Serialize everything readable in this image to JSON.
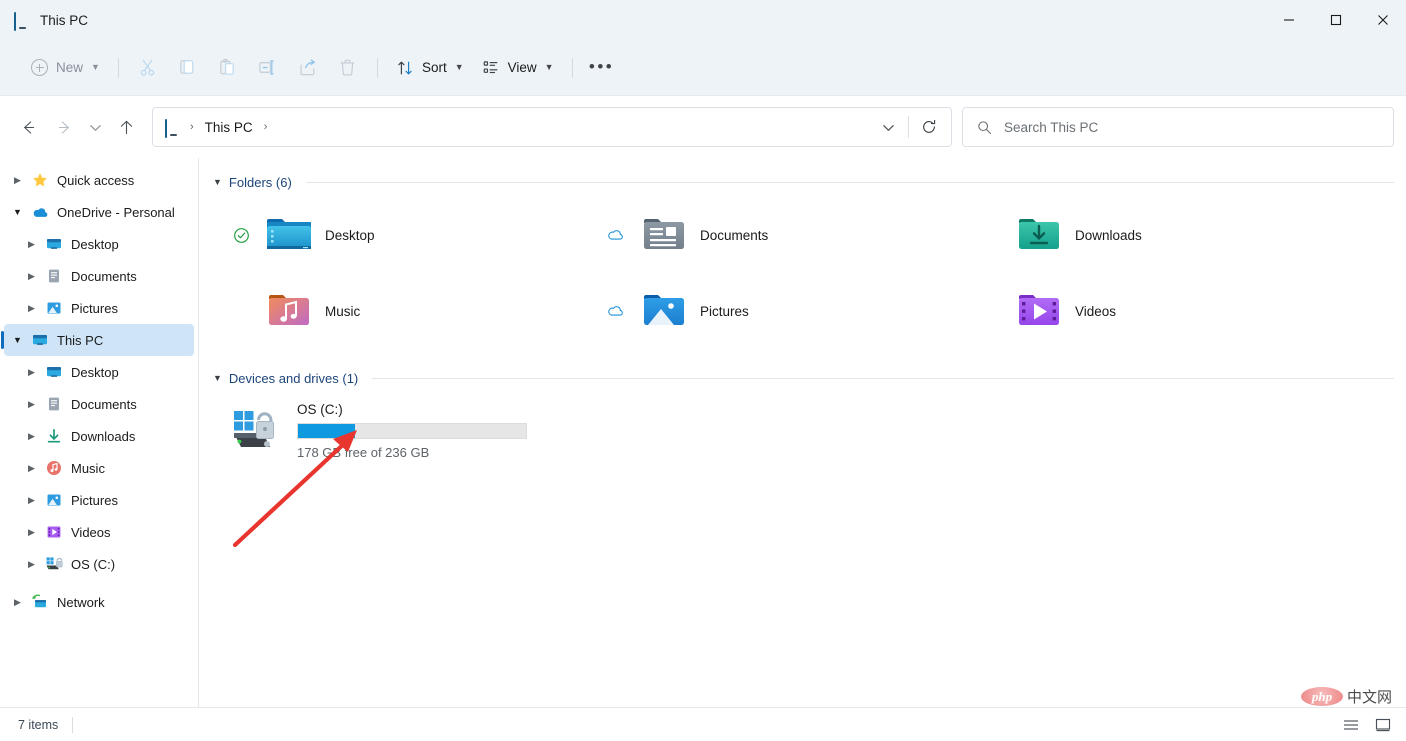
{
  "window": {
    "title": "This PC",
    "icon": "monitor-icon",
    "controls": {
      "minimize": "—",
      "maximize": "□",
      "close": "✕"
    }
  },
  "toolbar": {
    "new_label": "New",
    "sort_label": "Sort",
    "view_label": "View",
    "more_label": "•••",
    "icons": [
      "cut-icon",
      "copy-icon",
      "paste-icon",
      "rename-icon",
      "share-icon",
      "delete-icon"
    ]
  },
  "addressbar": {
    "back": "←",
    "forward": "→",
    "recent": "⌄",
    "up": "↑",
    "breadcrumbs": [
      "This PC"
    ],
    "separator": "›",
    "history_dropdown": "⌄",
    "refresh": "↻"
  },
  "search": {
    "placeholder": "Search This PC",
    "icon": "search-icon"
  },
  "sidebar": {
    "items": [
      {
        "label": "Quick access",
        "icon": "star-icon",
        "level": 1,
        "arrow": "collapsed",
        "selected": false
      },
      {
        "label": "OneDrive - Personal",
        "icon": "onedrive-icon",
        "level": 1,
        "arrow": "expanded",
        "selected": false
      },
      {
        "label": "Desktop",
        "icon": "desktop-icon",
        "level": 2,
        "arrow": "collapsed",
        "selected": false
      },
      {
        "label": "Documents",
        "icon": "documents-grey-icon",
        "level": 2,
        "arrow": "collapsed",
        "selected": false
      },
      {
        "label": "Pictures",
        "icon": "pictures-icon",
        "level": 2,
        "arrow": "collapsed",
        "selected": false
      },
      {
        "label": "This PC",
        "icon": "monitor-icon",
        "level": 1,
        "arrow": "expanded",
        "selected": true
      },
      {
        "label": "Desktop",
        "icon": "desktop-icon",
        "level": 2,
        "arrow": "collapsed",
        "selected": false
      },
      {
        "label": "Documents",
        "icon": "documents-grey-icon",
        "level": 2,
        "arrow": "collapsed",
        "selected": false
      },
      {
        "label": "Downloads",
        "icon": "downloads-icon",
        "level": 2,
        "arrow": "collapsed",
        "selected": false
      },
      {
        "label": "Music",
        "icon": "music-icon",
        "level": 2,
        "arrow": "collapsed",
        "selected": false
      },
      {
        "label": "Pictures",
        "icon": "pictures-icon",
        "level": 2,
        "arrow": "collapsed",
        "selected": false
      },
      {
        "label": "Videos",
        "icon": "videos-icon",
        "level": 2,
        "arrow": "collapsed",
        "selected": false
      },
      {
        "label": "OS (C:)",
        "icon": "drive-icon",
        "level": 2,
        "arrow": "collapsed",
        "selected": false
      },
      {
        "label": "Network",
        "icon": "network-icon",
        "level": 1,
        "arrow": "collapsed",
        "selected": false
      }
    ]
  },
  "main": {
    "groups": [
      {
        "title": "Folders (6)",
        "chevron": "⌄"
      },
      {
        "title": "Devices and drives (1)",
        "chevron": "⌄"
      }
    ],
    "folders": [
      {
        "name": "Desktop",
        "icon": "folder-desktop",
        "sync": "synced"
      },
      {
        "name": "Documents",
        "icon": "folder-documents",
        "sync": "cloud"
      },
      {
        "name": "Downloads",
        "icon": "folder-downloads",
        "sync": "none"
      },
      {
        "name": "Music",
        "icon": "folder-music",
        "sync": "none"
      },
      {
        "name": "Pictures",
        "icon": "folder-pictures",
        "sync": "cloud"
      },
      {
        "name": "Videos",
        "icon": "folder-videos",
        "sync": "none"
      }
    ],
    "drives": [
      {
        "name": "OS (C:)",
        "icon": "windows-drive-bitlocker-icon",
        "free_text": "178 GB free of 236 GB",
        "free_gb": 178,
        "total_gb": 236,
        "used_percent": 25,
        "bar_color": "#0f9ae0"
      }
    ]
  },
  "statusbar": {
    "items_text": "7 items",
    "view_list_icon": "list-view-icon",
    "view_details_icon": "details-view-icon"
  },
  "watermark": {
    "logo_text": "php",
    "site_text": "中文网"
  },
  "annotation": {
    "arrow_color": "#e8352e",
    "points_to": "178 GB free of 236 GB"
  },
  "colors": {
    "titlebar_bg": "#eef3f8",
    "accent": "#0f6cbd",
    "selection": "#cfe4f7",
    "group_title": "#1b4478"
  }
}
